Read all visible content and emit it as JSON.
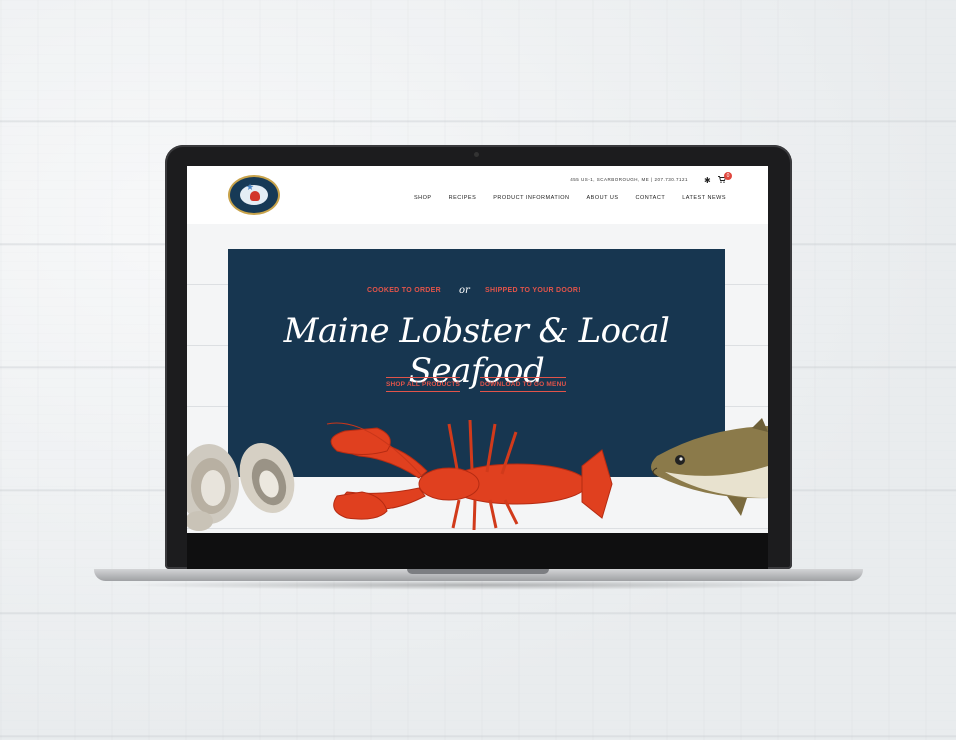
{
  "site": {
    "address_line": "455 US-1, SCARBOROUGH, ME | 207.730.7121",
    "cart_count": "0",
    "nav": [
      "SHOP",
      "RECIPES",
      "PRODUCT INFORMATION",
      "ABOUT US",
      "CONTACT",
      "LATEST NEWS"
    ],
    "logo_icon": "lobster-logo-icon"
  },
  "hero": {
    "tag_left": "COOKED TO ORDER",
    "tag_or": "or",
    "tag_right": "SHIPPED TO YOUR DOOR!",
    "title": "Maine Lobster & Local Seafood",
    "cta_shop": "SHOP ALL PRODUCTS",
    "cta_menu": "DOWNLOAD TO GO MENU"
  },
  "colors": {
    "hero_bg": "#173650",
    "accent": "#e2544a",
    "lobster": "#e0401f"
  }
}
